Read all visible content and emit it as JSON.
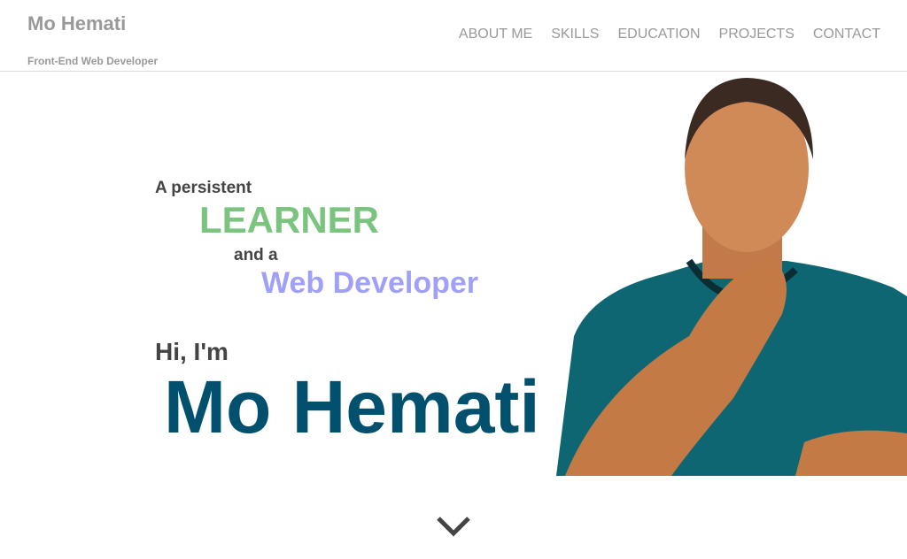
{
  "header": {
    "brand": "Mo Hemati",
    "tagline": "Front-End Web Developer",
    "nav": [
      "ABOUT ME",
      "SKILLS",
      "EDUCATION",
      "PROJECTS",
      "CONTACT"
    ]
  },
  "hero": {
    "line1": "A persistent",
    "line2": "LEARNER",
    "line3": "and a",
    "line4": "Web Developer",
    "greeting": "Hi, I'm",
    "name": "Mo Hemati"
  },
  "colors": {
    "learner": "#7bc47f",
    "web_developer": "#a0a0f8",
    "name": "#00506e",
    "muted": "#999999"
  },
  "icons": {
    "scroll": "chevron-down-icon"
  }
}
